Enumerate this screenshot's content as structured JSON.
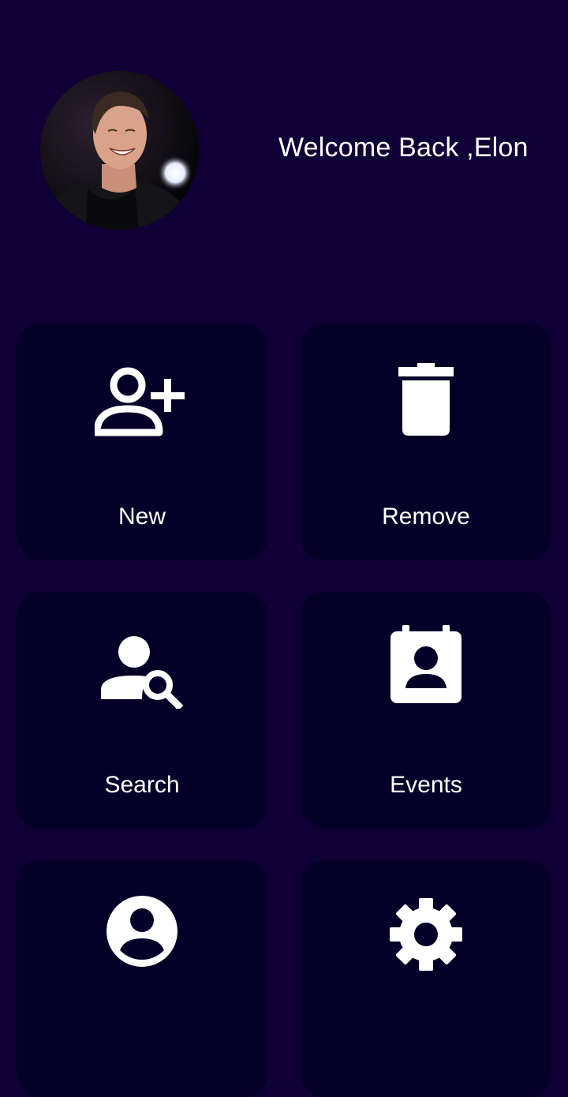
{
  "header": {
    "welcome_text": "Welcome Back ,Elon",
    "avatar_alt": "Profile photo"
  },
  "tiles": [
    {
      "label": "New",
      "icon": "person-add-icon"
    },
    {
      "label": "Remove",
      "icon": "trash-icon"
    },
    {
      "label": "Search",
      "icon": "person-search-icon"
    },
    {
      "label": "Events",
      "icon": "contact-calendar-icon"
    },
    {
      "label": "",
      "icon": "account-circle-icon"
    },
    {
      "label": "",
      "icon": "gear-icon"
    }
  ],
  "colors": {
    "background": "#0f0035",
    "tile": "#050028",
    "text": "#ffffff"
  }
}
